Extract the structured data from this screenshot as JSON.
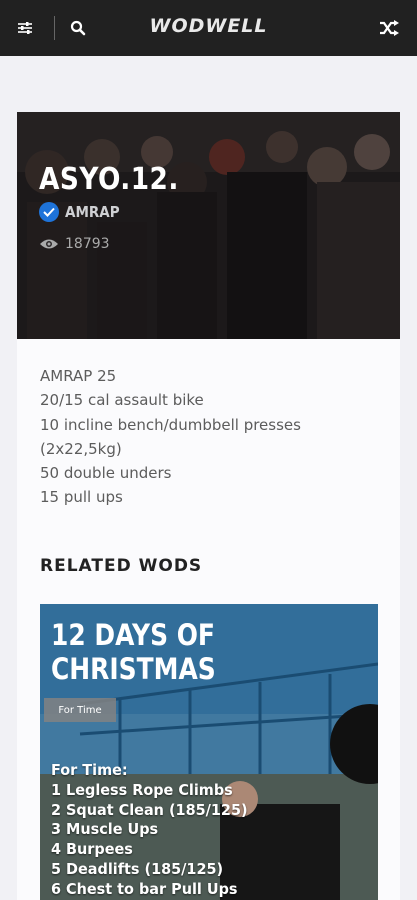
{
  "app": {
    "brand": "WODWELL"
  },
  "toolbar": {
    "filter_icon": "sliders-icon",
    "search_icon": "search-icon",
    "shuffle_icon": "shuffle-icon"
  },
  "workout": {
    "title": "ASYO.12.",
    "type": "AMRAP",
    "views": "18793",
    "description": [
      "AMRAP 25",
      "20/15 cal assault bike",
      "10 incline bench/dumbbell presses",
      "(2x22,5kg)",
      "50 double unders",
      "15 pull ups"
    ]
  },
  "related": {
    "heading": "RELATED WODS",
    "card": {
      "title_line1": "12 DAYS OF",
      "title_line2": "CHRISTMAS",
      "badge": "For Time",
      "lines": [
        "For Time:",
        "1 Legless Rope Climbs",
        "2 Squat Clean (185/125)",
        "3 Muscle Ups",
        "4 Burpees",
        "5 Deadlifts (185/125)",
        "6 Chest to bar Pull Ups"
      ]
    }
  },
  "colors": {
    "topbar": "#212121",
    "accent_blue": "#1e73d9",
    "background": "#f1f1f5"
  }
}
